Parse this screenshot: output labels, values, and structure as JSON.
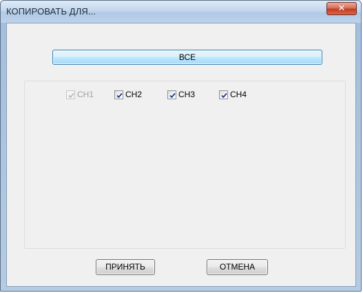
{
  "window": {
    "title": "КОПИРОВАТЬ ДЛЯ...",
    "close_glyph": "✕"
  },
  "dialog": {
    "all_button": "ВСЕ",
    "channels": [
      {
        "label": "CH1",
        "checked": true,
        "enabled": false
      },
      {
        "label": "CH2",
        "checked": true,
        "enabled": true
      },
      {
        "label": "CH3",
        "checked": true,
        "enabled": true
      },
      {
        "label": "CH4",
        "checked": true,
        "enabled": true
      }
    ],
    "accept_button": "ПРИНЯТЬ",
    "cancel_button": "ОТМЕНА"
  },
  "colors": {
    "check_enabled": "#1f3a93",
    "check_disabled": "#b9b9b9"
  }
}
